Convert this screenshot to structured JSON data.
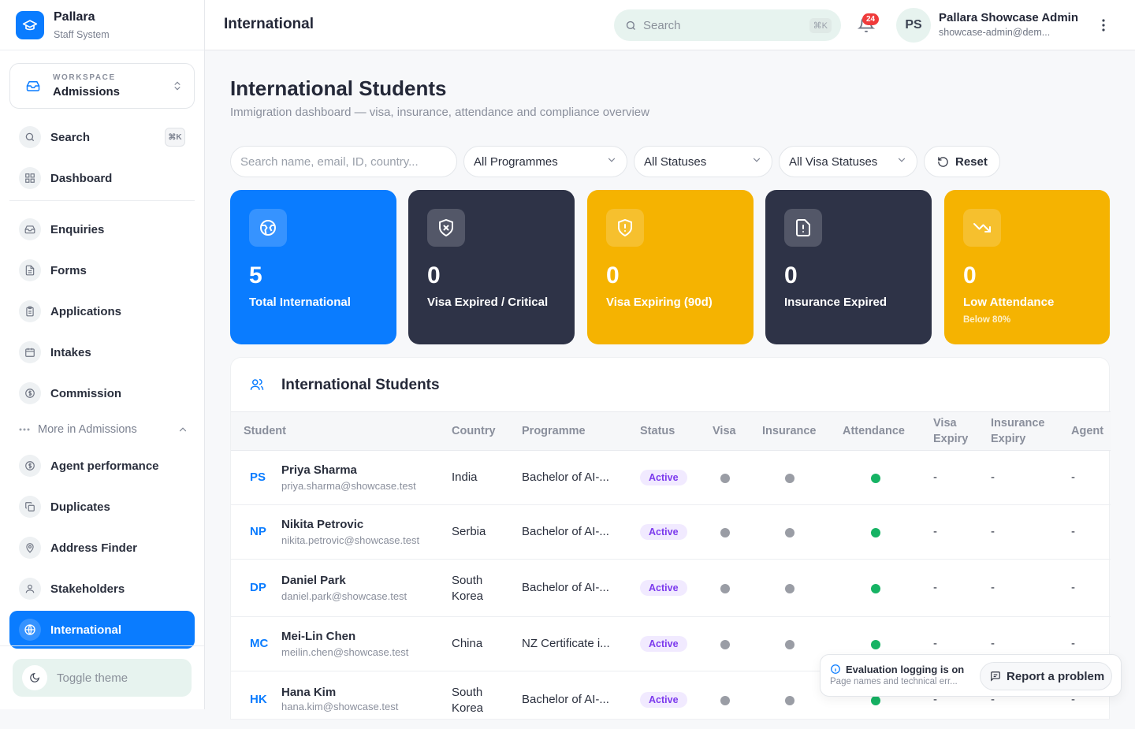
{
  "brand": {
    "name": "Pallara",
    "subtitle": "Staff System"
  },
  "workspace": {
    "label": "WORKSPACE",
    "value": "Admissions"
  },
  "sidebar": {
    "search_label": "Search",
    "search_shortcut": "⌘K",
    "dashboard": "Dashboard",
    "items": [
      "Enquiries",
      "Forms",
      "Applications",
      "Intakes",
      "Commission"
    ],
    "more_label": "More in Admissions",
    "more_items": [
      "Agent performance",
      "Duplicates",
      "Address Finder",
      "Stakeholders",
      "International"
    ],
    "active_item": "International",
    "toggle_theme": "Toggle theme"
  },
  "header": {
    "title": "International",
    "search_placeholder": "Search",
    "search_shortcut": "⌘K",
    "notifications_count": "24",
    "user_initials": "PS",
    "user_name": "Pallara Showcase Admin",
    "user_email": "showcase-admin@dem..."
  },
  "main": {
    "title": "International Students",
    "subtitle": "Immigration dashboard — visa, insurance, attendance and compliance overview"
  },
  "filters": {
    "search_placeholder": "Search name, email, ID, country...",
    "programme": "All Programmes",
    "status": "All Statuses",
    "visa_status": "All Visa Statuses",
    "reset": "Reset"
  },
  "cards": [
    {
      "value": "5",
      "label": "Total International",
      "icon": "globe-icon",
      "color": "#0a7cff"
    },
    {
      "value": "0",
      "label": "Visa Expired / Critical",
      "icon": "shield-x-icon",
      "color": "#2e3347"
    },
    {
      "value": "0",
      "label": "Visa Expiring (90d)",
      "icon": "shield-alert-icon",
      "color": "#f5b301"
    },
    {
      "value": "0",
      "label": "Insurance Expired",
      "icon": "file-alert-icon",
      "color": "#2e3347"
    },
    {
      "value": "0",
      "label": "Low Attendance",
      "sub": "Below 80%",
      "icon": "trending-down-icon",
      "color": "#f5b301"
    }
  ],
  "table": {
    "title": "International Students",
    "headers": {
      "student": "Student",
      "country": "Country",
      "programme": "Programme",
      "status": "Status",
      "visa": "Visa",
      "insurance": "Insurance",
      "attendance": "Attendance",
      "visa_expiry": "Visa Expiry",
      "insurance_expiry": "Insurance Expiry",
      "agent": "Agent"
    },
    "rows": [
      {
        "initials": "PS",
        "name": "Priya Sharma",
        "email": "priya.sharma@showcase.test",
        "country": "India",
        "programme": "Bachelor of AI-...",
        "status": "Active",
        "visa_expiry": "-",
        "insurance_expiry": "-",
        "agent": "-"
      },
      {
        "initials": "NP",
        "name": "Nikita Petrovic",
        "email": "nikita.petrovic@showcase.test",
        "country": "Serbia",
        "programme": "Bachelor of AI-...",
        "status": "Active",
        "visa_expiry": "-",
        "insurance_expiry": "-",
        "agent": "-"
      },
      {
        "initials": "DP",
        "name": "Daniel Park",
        "email": "daniel.park@showcase.test",
        "country": "South Korea",
        "programme": "Bachelor of AI-...",
        "status": "Active",
        "visa_expiry": "-",
        "insurance_expiry": "-",
        "agent": "-"
      },
      {
        "initials": "MC",
        "name": "Mei-Lin Chen",
        "email": "meilin.chen@showcase.test",
        "country": "China",
        "programme": "NZ Certificate i...",
        "status": "Active",
        "visa_expiry": "-",
        "insurance_expiry": "-",
        "agent": "-"
      },
      {
        "initials": "HK",
        "name": "Hana Kim",
        "email": "hana.kim@showcase.test",
        "country": "South Korea",
        "programme": "Bachelor of AI-...",
        "status": "Active",
        "visa_expiry": "-",
        "insurance_expiry": "-",
        "agent": "-"
      }
    ]
  },
  "toast": {
    "title": "Evaluation logging is on",
    "subtitle": "Page names and technical err...",
    "button": "Report a problem"
  },
  "colors": {
    "accent": "#0a7cff",
    "dot_grey": "#9a9da5",
    "dot_green": "#16b364",
    "status_purple": "#7c3aed"
  }
}
